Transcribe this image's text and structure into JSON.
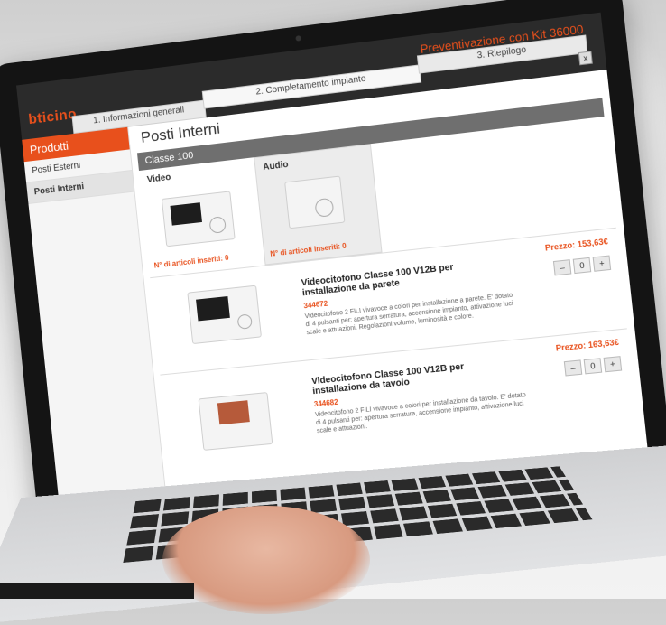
{
  "app": {
    "brand": "bticino",
    "kit_title": "Preventivazione con Kit 36000"
  },
  "steps": [
    {
      "label": "1. Informazioni generali"
    },
    {
      "label": "2. Completamento impianto"
    },
    {
      "label": "3. Riepilogo"
    }
  ],
  "window_controls": {
    "close": "x"
  },
  "sidebar": {
    "header": "Prodotti",
    "items": [
      {
        "label": "Posti Esterni"
      },
      {
        "label": "Posti Interni"
      }
    ]
  },
  "main": {
    "title": "Posti Interni",
    "section": "Classe 100",
    "categories": [
      {
        "label": "Video",
        "count_text": "N° di articoli inseriti: 0"
      },
      {
        "label": "Audio",
        "count_text": "N° di articoli inseriti: 0"
      }
    ],
    "products": [
      {
        "name": "Videocitofono Classe 100 V12B per installazione da parete",
        "code": "344672",
        "description": "Videocitofono 2 FILI vivavoce a colori per installazione a parete. E' dotato di 4 pulsanti per: apertura serratura, accensione impianto, attivazione luci scale e attuazioni. Regolazioni volume, luminosità e colore.",
        "price": "Prezzo: 153,63€",
        "qty": "0"
      },
      {
        "name": "Videocitofono Classe 100 V12B per installazione da tavolo",
        "code": "344682",
        "description": "Videocitofono 2 FILI vivavoce a colori per installazione da tavolo. E' dotato di 4 pulsanti per: apertura serratura, accensione impianto, attivazione luci scale e attuazioni.",
        "price": "Prezzo: 163,63€",
        "qty": "0"
      }
    ],
    "qty_minus": "–",
    "qty_plus": "+"
  },
  "colors": {
    "accent": "#e8501c",
    "header": "#2b2b2b",
    "section": "#6f6f6f"
  }
}
